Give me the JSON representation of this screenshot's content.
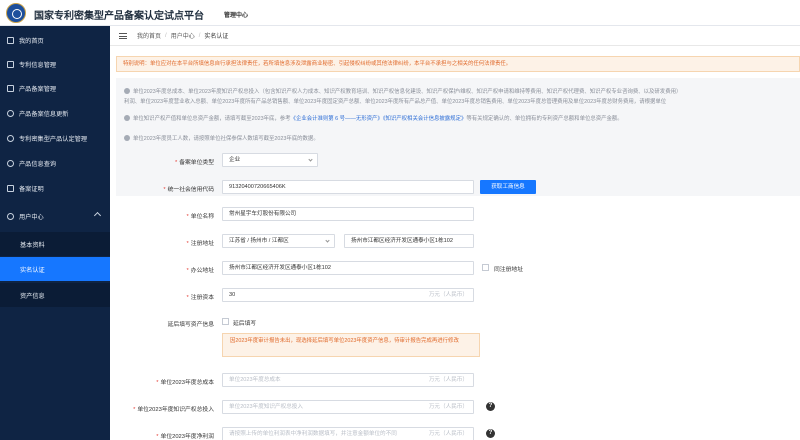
{
  "header": {
    "title": "国家专利密集型产品备案认定试点平台",
    "subtitle": "管理中心"
  },
  "sidebar": {
    "items": [
      {
        "label": "我的首页",
        "icon": "home-icon"
      },
      {
        "label": "专利信息管理",
        "icon": "file-icon"
      },
      {
        "label": "产品备案管理",
        "icon": "folder-icon"
      },
      {
        "label": "产品备案信息更新",
        "icon": "refresh-icon"
      },
      {
        "label": "专利密集型产品认定管理",
        "icon": "settings-icon"
      },
      {
        "label": "产品信息查询",
        "icon": "search-icon"
      },
      {
        "label": "备案证明",
        "icon": "certificate-icon"
      },
      {
        "label": "用户中心",
        "icon": "user-icon"
      }
    ],
    "sub_items": [
      {
        "label": "基本资料"
      },
      {
        "label": "实名认证"
      },
      {
        "label": "资产信息"
      }
    ]
  },
  "breadcrumb": {
    "items": [
      "我的首页",
      "用户中心",
      "实名认证"
    ]
  },
  "notice": {
    "special": "特别说明：单位应对在本平台所填信息自行承担法律责任，若所填信息涉及泄露商业秘密、引起侵权纠纷或其他法律纠纷，本平台不承担与之相关的任何法律责任。",
    "line1": "单位2023年度总成本、单位2023年度知识产权总投入（包含知识产权人力成本、知识产权教育培训、知识产权信息化建设、知识产权保护/维权、知识产权申请和维持等费用、知识产权代理费、知识产权专业咨询费、以及研发费用）",
    "line2": "利润、单位2023年度营业收入总额、单位2023年度所有产品总销售额、单位2023年度固定资产总额、单位2023年度所有产品总产值、单位2023年度总销售费用、单位2023年度总管理费用及单位2023年度总财务费用，请根据单位",
    "line3_pre": "单位知识产权产值和单位总资产金额，请填写截至2023年底，参考",
    "line3_link1": "《企业会计准则第 6 号——无形资产》",
    "line3_link2": "《知识产权相关会计信息披露规定》",
    "line3_post": "等有关规定确认的、单位拥有的专利资产总额和单位总资产金额。",
    "line4": "单位2023年度员工人数，请按照单位社保参保人数填写截至2023年底的数据。"
  },
  "form": {
    "unit_type": {
      "label": "备案单位类型",
      "value": "企业"
    },
    "credit_code": {
      "label": "统一社会信用代码",
      "value": "91320400720665406K",
      "button": "获取工商信息"
    },
    "unit_name": {
      "label": "单位名称",
      "value": "常州星宇车灯股份有限公司"
    },
    "reg_address": {
      "label": "注册地址",
      "region": "江苏省 / 扬州市 / 江都区",
      "detail": "扬州市江都区经济开发区通泰小区1栋102"
    },
    "office_address": {
      "label": "办公地址",
      "value": "扬州市江都区经济开发区通泰小区1栋102",
      "same_label": "同注册地址"
    },
    "reg_capital": {
      "label": "注册资本",
      "value": "30",
      "unit": "万元（人民币）"
    },
    "delay_fill": {
      "label": "延后填写资产信息",
      "check_label": "延后填写"
    },
    "delay_note": "因2023年度审计报告未出，现选择延后填写单位2023年度资产信息，待审计报告完成再进行修改",
    "total_cost": {
      "label": "单位2023年度总成本",
      "placeholder": "单位2023年度总成本",
      "unit": "万元（人民币）"
    },
    "ip_investment": {
      "label": "单位2023年度知识产权总投入",
      "placeholder": "单位2023年度知识产权总投入",
      "unit": "万元（人民币）"
    },
    "net_profit": {
      "label": "单位2023年度净利润",
      "placeholder": "请按照上传的单位利润表中净利润数据填写，并注意金额单位的不同",
      "unit": "万元（人民币）"
    }
  }
}
